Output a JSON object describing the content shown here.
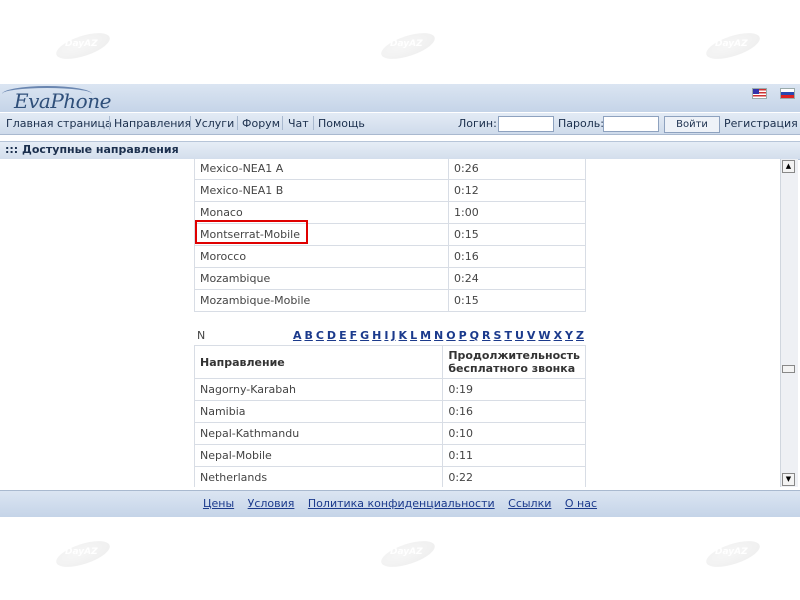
{
  "logo": "EvaPhone",
  "watermark": "DayAZ",
  "nav": [
    "Главная страница",
    "Направления",
    "Услуги",
    "Форум",
    "Чат",
    "Помощь"
  ],
  "login": {
    "login_label": "Логин:",
    "password_label": "Пароль:",
    "submit": "Войти",
    "register": "Регистрация"
  },
  "section_title": "::: Доступные направления",
  "table_m": [
    [
      "Mexico-NEA1 A",
      "0:26"
    ],
    [
      "Mexico-NEA1 B",
      "0:12"
    ],
    [
      "Monaco",
      "1:00"
    ],
    [
      "Montserrat-Mobile",
      "0:15"
    ],
    [
      "Morocco",
      "0:16"
    ],
    [
      "Mozambique",
      "0:24"
    ],
    [
      "Mozambique-Mobile",
      "0:15"
    ]
  ],
  "current_letter": "N",
  "alphabet": [
    "A",
    "B",
    "C",
    "D",
    "E",
    "F",
    "G",
    "H",
    "I",
    "J",
    "K",
    "L",
    "M",
    "N",
    "O",
    "P",
    "Q",
    "R",
    "S",
    "T",
    "U",
    "V",
    "W",
    "X",
    "Y",
    "Z"
  ],
  "table_n": {
    "headers": [
      "Направление",
      "Продолжительность бесплатного звонка"
    ],
    "rows": [
      [
        "Nagorny-Karabah",
        "0:19"
      ],
      [
        "Namibia",
        "0:16"
      ],
      [
        "Nepal-Kathmandu",
        "0:10"
      ],
      [
        "Nepal-Mobile",
        "0:11"
      ],
      [
        "Netherlands",
        "0:22"
      ]
    ]
  },
  "footer": [
    "Цены",
    "Условия",
    "Политика конфиденциальности",
    "Ссылки",
    "О нас"
  ],
  "colors": {
    "accent": "#1b3a8c",
    "header_bg": "#c5d4e8",
    "highlight": "#e00000"
  }
}
